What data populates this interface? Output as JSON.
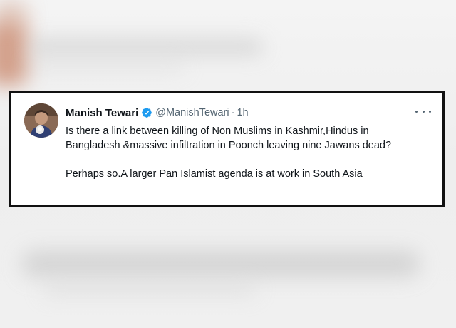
{
  "tweet": {
    "display_name": "Manish Tewari",
    "handle": "@ManishTewari",
    "separator": "·",
    "timestamp": "1h",
    "verified": true,
    "paragraphs": [
      "Is there a link between killing of Non Muslims in Kashmir,Hindus in Bangladesh &massive infiltration in Poonch leaving nine Jawans dead?",
      "Perhaps so.A larger Pan Islamist agenda is at work in South Asia"
    ],
    "more_icon": "more-horizontal-icon",
    "verified_icon": "verified-badge-icon",
    "colors": {
      "verified": "#1d9bf0",
      "name": "#0f1419",
      "secondary": "#536471",
      "card_border": "#111111"
    }
  }
}
